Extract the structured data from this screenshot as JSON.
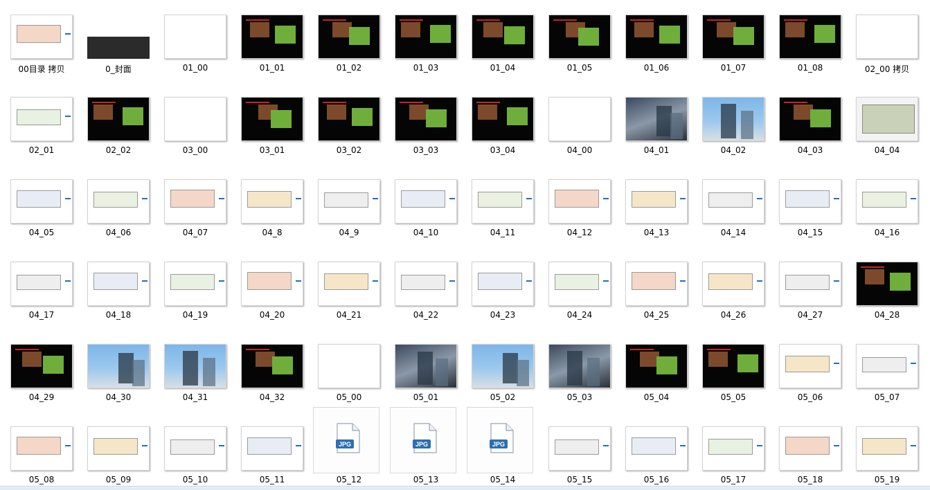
{
  "files": [
    [
      "00目录 拷贝",
      "0_封面",
      "01_00",
      "01_01",
      "01_02",
      "01_03",
      "01_04",
      "01_05",
      "01_06",
      "01_07",
      "01_08",
      "02_00 拷贝"
    ],
    [
      "02_01",
      "02_02",
      "03_00",
      "03_01",
      "03_02",
      "03_03",
      "03_04",
      "04_00",
      "04_01",
      "04_02",
      "04_03",
      "04_04"
    ],
    [
      "04_05",
      "04_06",
      "04_07",
      "04_8",
      "04_9",
      "04_10",
      "04_11",
      "04_12",
      "04_13",
      "04_14",
      "04_15",
      "04_16"
    ],
    [
      "04_17",
      "04_18",
      "04_19",
      "04_20",
      "04_21",
      "04_22",
      "04_23",
      "04_24",
      "04_25",
      "04_26",
      "04_27",
      "04_28"
    ],
    [
      "04_29",
      "04_30",
      "04_31",
      "04_32",
      "05_00",
      "05_01",
      "05_02",
      "05_03",
      "05_04",
      "05_05",
      "05_06",
      "05_07"
    ],
    [
      "05_08",
      "05_09",
      "05_10",
      "05_11",
      "05_12",
      "05_13",
      "05_14",
      "05_15",
      "05_16",
      "05_17",
      "05_18",
      "05_19"
    ]
  ],
  "styles": [
    [
      "white",
      "white",
      "white",
      "dark",
      "dark",
      "dark",
      "dark",
      "dark",
      "dark",
      "dark",
      "dark",
      "white"
    ],
    [
      "white",
      "dark",
      "white",
      "dark",
      "dark",
      "dark",
      "dark",
      "white",
      "photo",
      "sky",
      "dark",
      "grey"
    ],
    [
      "white",
      "white",
      "white",
      "white",
      "white",
      "white",
      "white",
      "white",
      "white",
      "white",
      "white",
      "white"
    ],
    [
      "white",
      "white",
      "white",
      "white",
      "white",
      "white",
      "white",
      "white",
      "white",
      "white",
      "white",
      "dark"
    ],
    [
      "dark",
      "sky",
      "sky",
      "dark",
      "white",
      "photo",
      "sky",
      "photo",
      "dark",
      "dark",
      "white",
      "white"
    ],
    [
      "white",
      "white",
      "white",
      "white",
      "jpg",
      "jpg",
      "jpg",
      "white",
      "white",
      "white",
      "white",
      "white"
    ]
  ],
  "jpg_badge": "JPG",
  "colors": {
    "accent_blue": "#1d6fc2",
    "accent_red": "#c8232b"
  }
}
